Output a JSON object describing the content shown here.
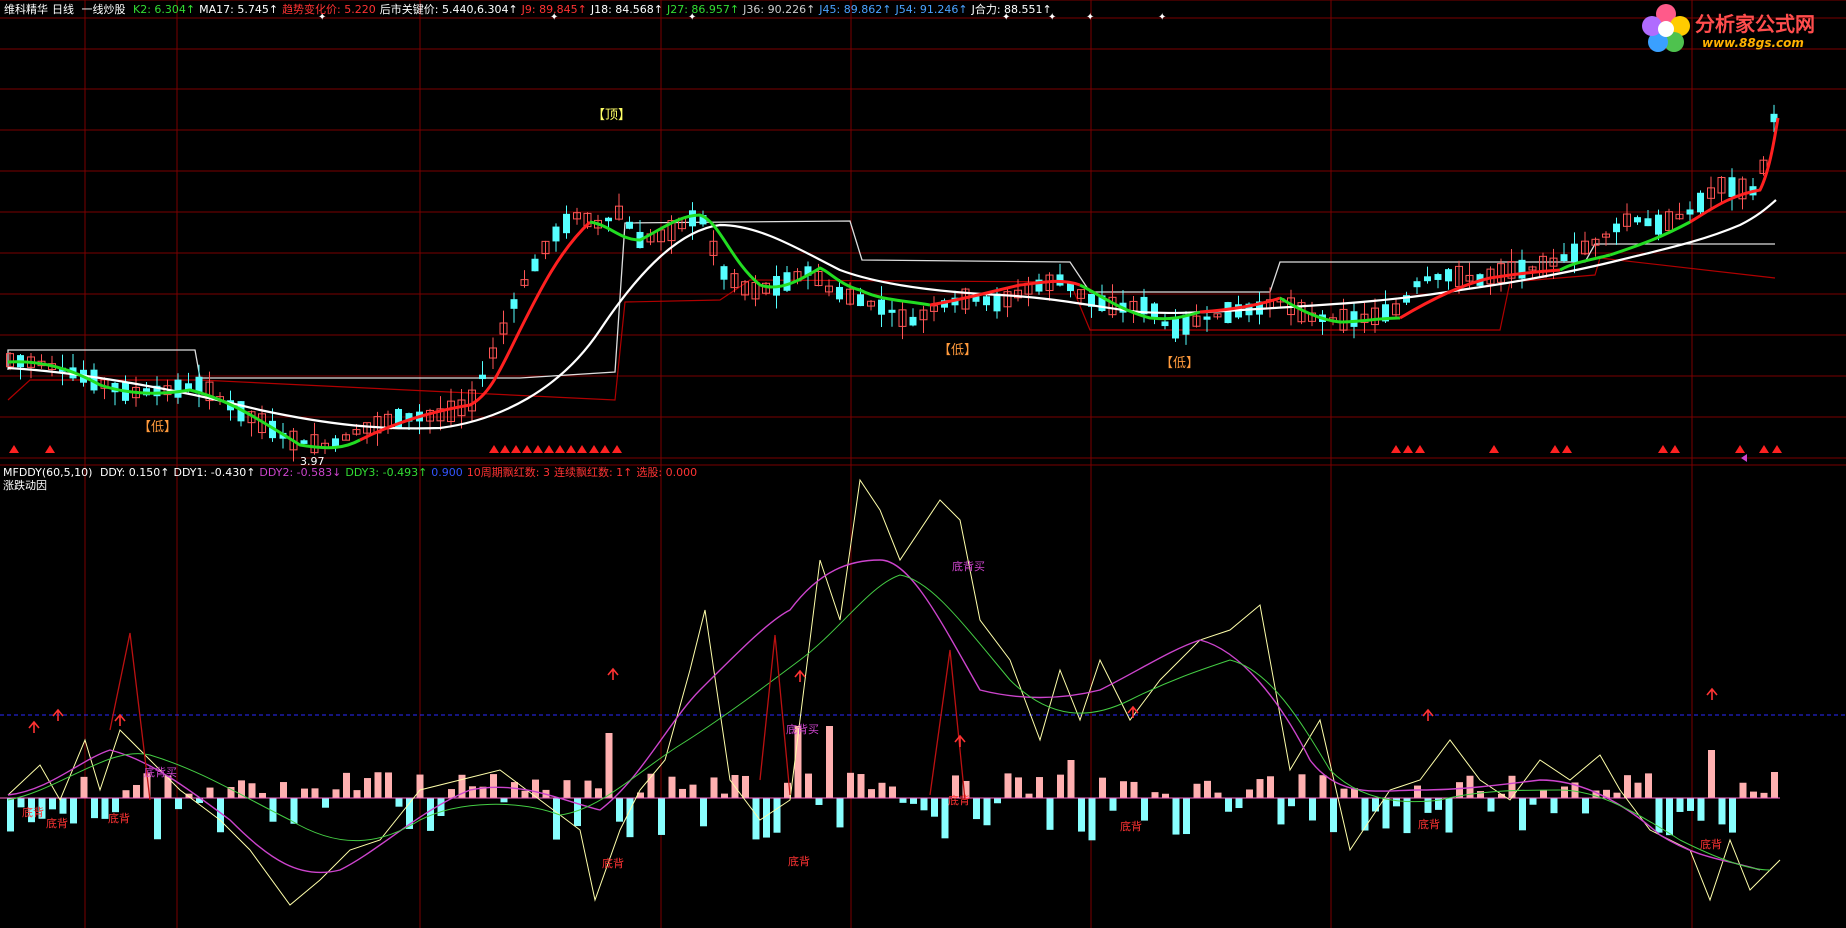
{
  "logo": {
    "title": "分析家公式网",
    "url": "www.88gs.com"
  },
  "main_header": {
    "stock": "维科精华",
    "period": "日线",
    "formula": "一线炒股",
    "items": [
      {
        "label": "K2:",
        "value": "6.304↑",
        "color": "#33dd33"
      },
      {
        "label": "MA17:",
        "value": "5.745↑",
        "color": "#ffffff"
      },
      {
        "label": "趋势变化价:",
        "value": "5.220",
        "color": "#ff3333"
      },
      {
        "label": "后市关键价:",
        "value": "5.440,6.304↑",
        "color": "#ffffff"
      },
      {
        "label": "J9:",
        "value": "89.845↑",
        "color": "#ff3333"
      },
      {
        "label": "J18:",
        "value": "84.568↑",
        "color": "#ffffff"
      },
      {
        "label": "J27:",
        "value": "86.957↑",
        "color": "#33dd33"
      },
      {
        "label": "J36:",
        "value": "90.226↑",
        "color": "#cccccc"
      },
      {
        "label": "J45:",
        "value": "89.862↑",
        "color": "#4aa3ff"
      },
      {
        "label": "J54:",
        "value": "91.246↑",
        "color": "#4aa3ff"
      },
      {
        "label": "J合力:",
        "value": "88.551↑",
        "color": "#ffffff"
      }
    ]
  },
  "sub_header": {
    "formula": "MFDDY(60,5,10)",
    "items": [
      {
        "label": "DDY:",
        "value": "0.150↑",
        "color": "#ffffff"
      },
      {
        "label": "DDY1:",
        "value": "-0.430↑",
        "color": "#ffffff"
      },
      {
        "label": "DDY2:",
        "value": "-0.583↓",
        "color": "#cc44cc"
      },
      {
        "label": "DDY3:",
        "value": "-0.493↑",
        "color": "#33dd33"
      },
      {
        "label": "",
        "value": "0.900",
        "color": "#3355ff"
      },
      {
        "label": "10周期飘红数:",
        "value": "3",
        "color": "#ff3333"
      },
      {
        "label": "连续飘红数:",
        "value": "1↑",
        "color": "#ff3333"
      },
      {
        "label": "选股:",
        "value": "0.000",
        "color": "#ff3333"
      }
    ],
    "subtitle": "涨跌动因"
  },
  "annotations": {
    "top": "【顶】",
    "low": "【低】",
    "min_price": "3.97",
    "dibei": "底背",
    "dibei_mai": "底背买",
    "dibei_chao": "底背买"
  },
  "chart_data": {
    "type": "candlestick",
    "main_overlays": [
      "K2",
      "MA17",
      "趋势变化价",
      "后市关键价"
    ],
    "low_price_label": 3.97,
    "sub_type": "histogram+lines",
    "sub_series": [
      "DDY",
      "DDY1",
      "DDY2",
      "DDY3"
    ]
  },
  "colors": {
    "up": "#ff5555",
    "down": "#55ffff",
    "grid": "#7a0000",
    "k2_up": "#ff2020",
    "k2_down": "#22dd22",
    "ma": "#ffffff",
    "step": "#dddddd",
    "trend": "#b00000"
  }
}
